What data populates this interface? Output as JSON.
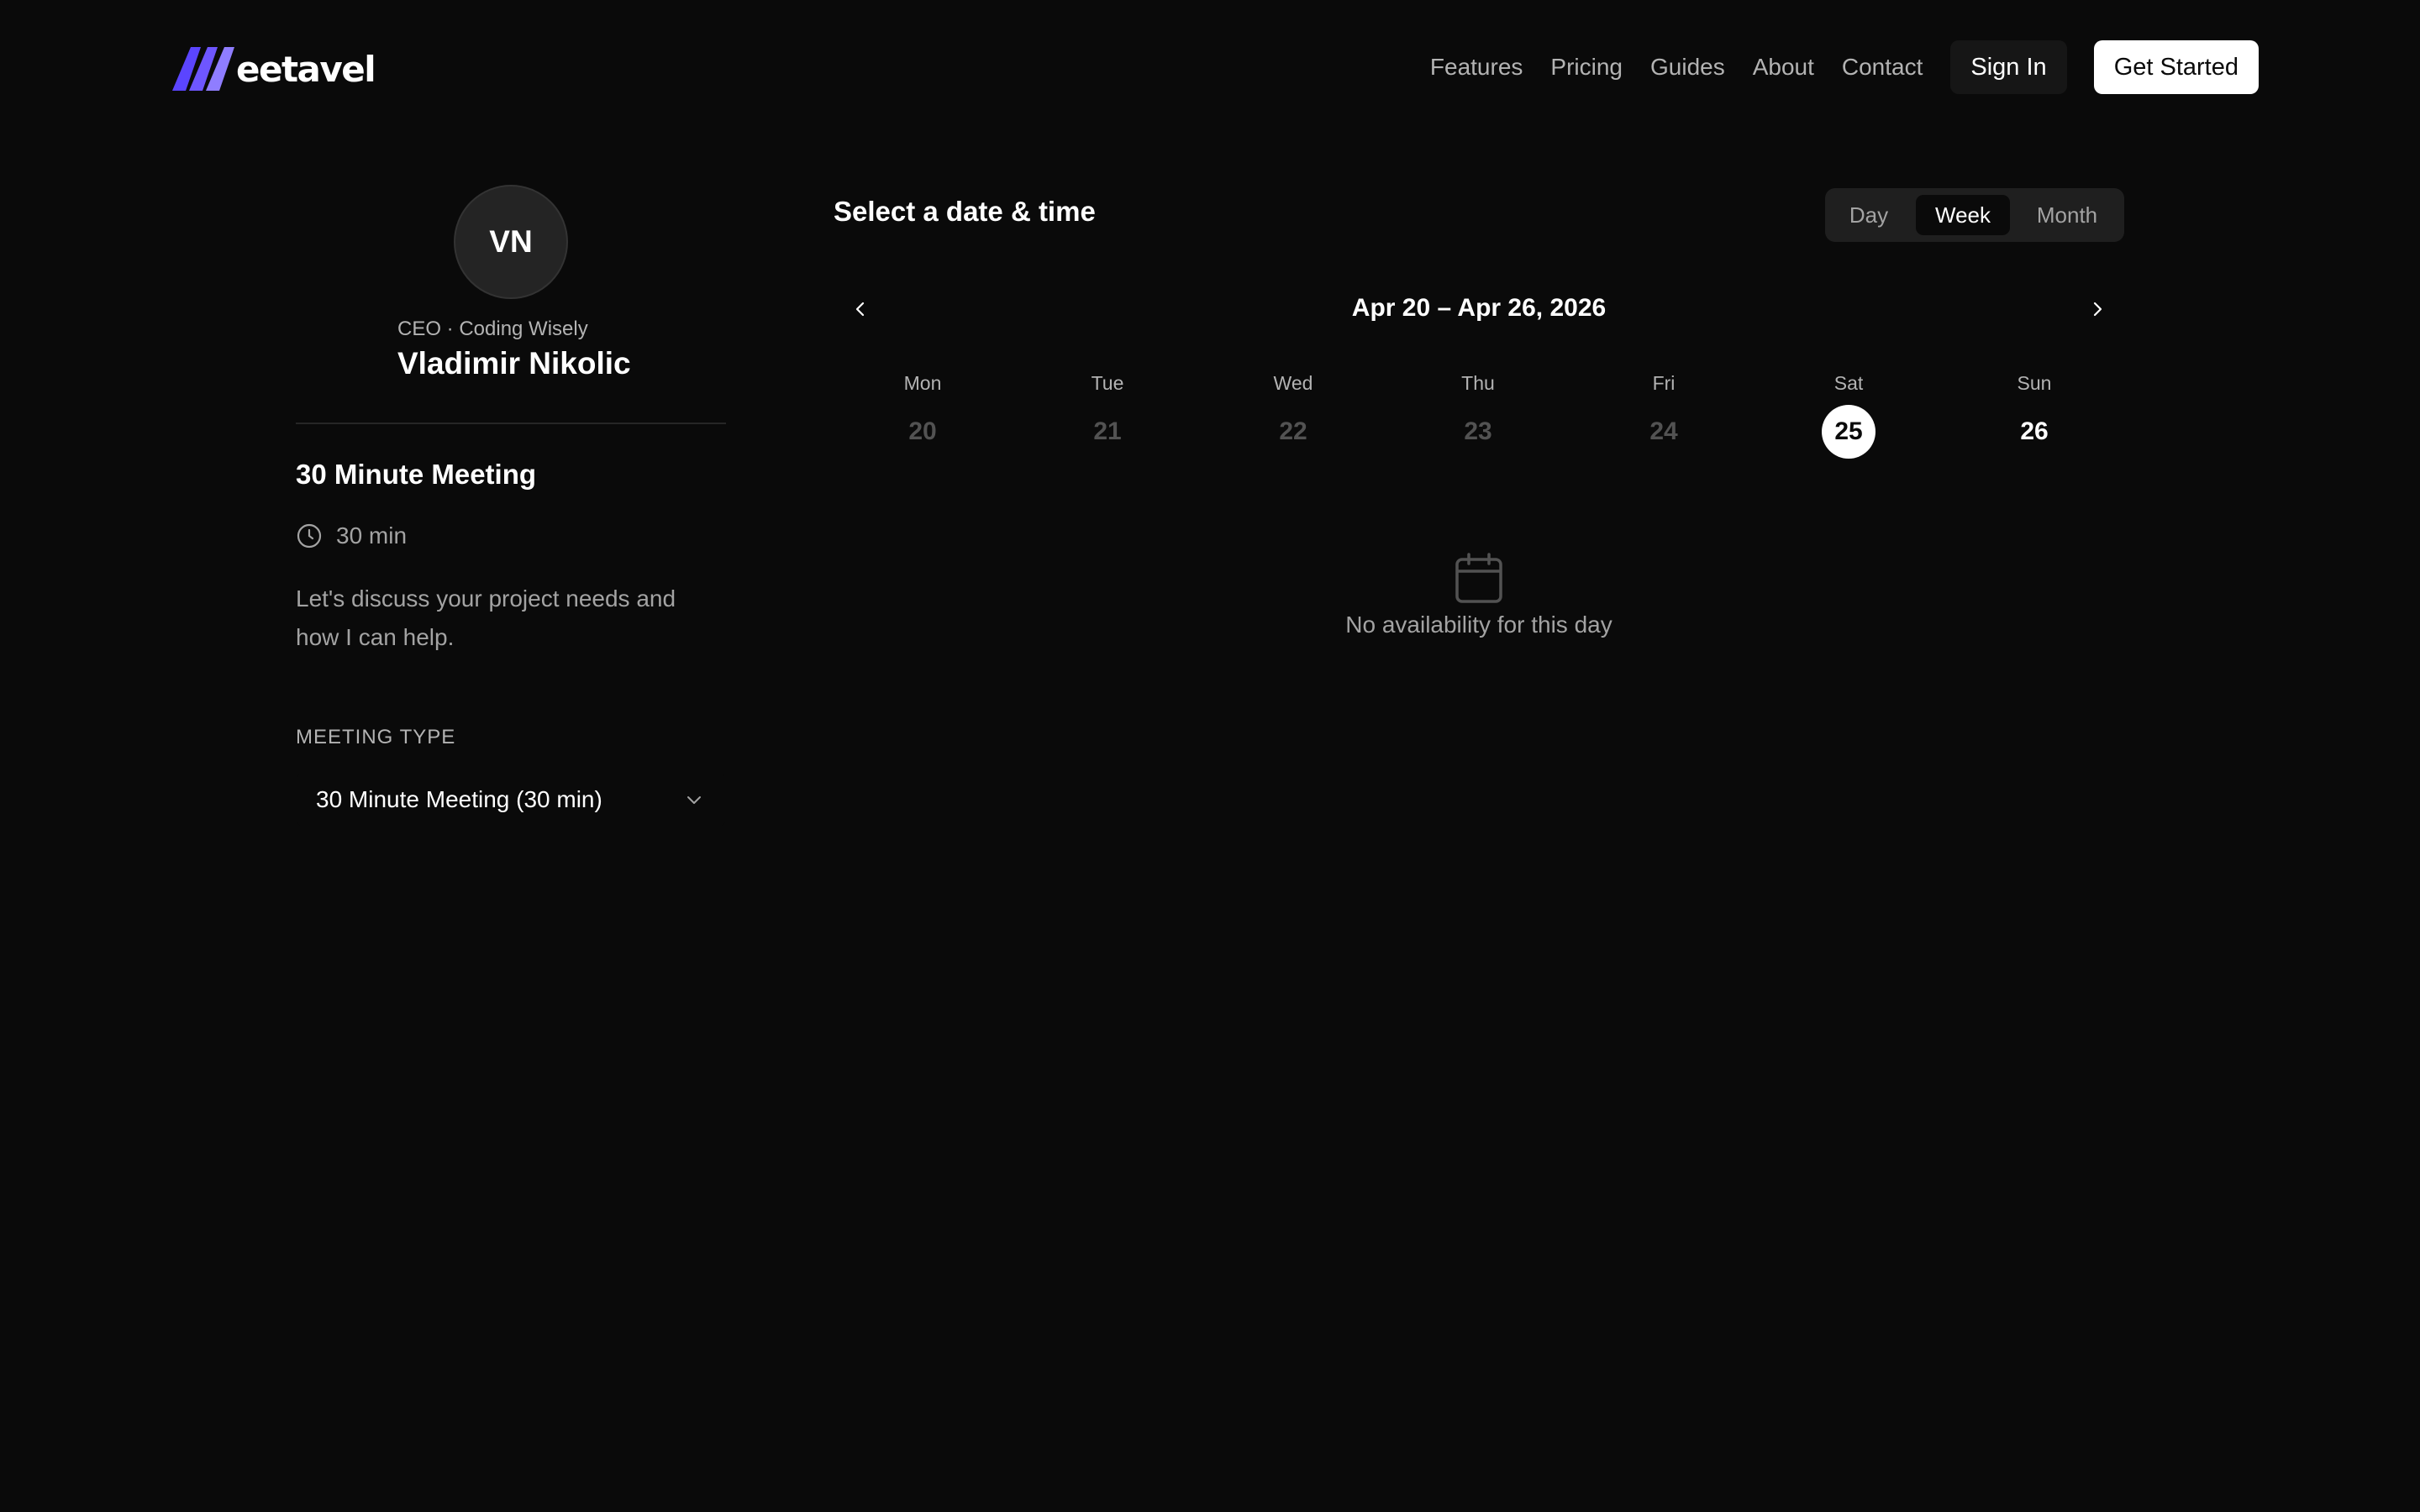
{
  "brand": {
    "name": "eetavel",
    "mark_colors": [
      "#5b45ff",
      "#6e56ff",
      "#8f7dff"
    ]
  },
  "nav": {
    "links": [
      "Features",
      "Pricing",
      "Guides",
      "About",
      "Contact"
    ],
    "sign_in": "Sign In",
    "get_started": "Get Started"
  },
  "host": {
    "initials": "VN",
    "subtitle": "CEO · Coding Wisely",
    "name": "Vladimir Nikolic"
  },
  "meeting": {
    "title": "30 Minute Meeting",
    "duration": "30 min",
    "description": "Let's discuss your project needs and how I can help.",
    "type_label": "MEETING TYPE",
    "type_value": "30 Minute Meeting (30 min)"
  },
  "calendar": {
    "title": "Select a date & time",
    "views": [
      "Day",
      "Week",
      "Month"
    ],
    "active_view": "Week",
    "range": "Apr 20 – Apr 26, 2026",
    "days": [
      {
        "name": "Mon",
        "num": "20",
        "state": "disabled"
      },
      {
        "name": "Tue",
        "num": "21",
        "state": "disabled"
      },
      {
        "name": "Wed",
        "num": "22",
        "state": "disabled"
      },
      {
        "name": "Thu",
        "num": "23",
        "state": "disabled"
      },
      {
        "name": "Fri",
        "num": "24",
        "state": "disabled"
      },
      {
        "name": "Sat",
        "num": "25",
        "state": "selected"
      },
      {
        "name": "Sun",
        "num": "26",
        "state": "available"
      }
    ],
    "empty_message": "No availability for this day"
  },
  "colors": {
    "background": "#0a0a0a",
    "accent": "#5b45ff",
    "text_muted": "#a3a3a3",
    "disabled_day": "#525252"
  },
  "icons": {
    "prev": "chevron-left-icon",
    "next": "chevron-right-icon",
    "clock": "clock-icon",
    "dropdown": "chevron-down-icon",
    "empty": "calendar-icon"
  }
}
